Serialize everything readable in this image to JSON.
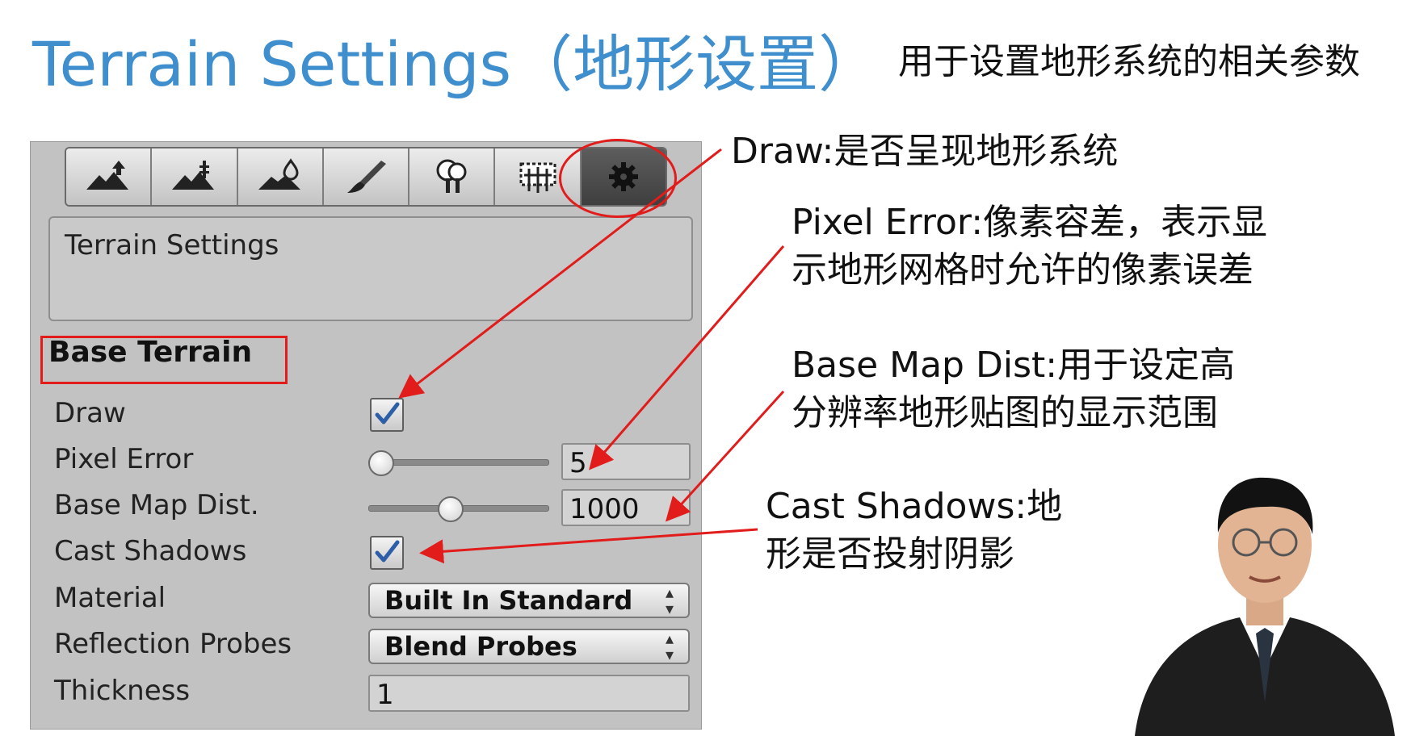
{
  "header": {
    "title": "Terrain Settings（地形设置）",
    "subtitle": "用于设置地形系统的相关参数"
  },
  "toolbar": {
    "tools": [
      {
        "icon": "raise-terrain-icon"
      },
      {
        "icon": "paint-height-icon"
      },
      {
        "icon": "smooth-height-icon"
      },
      {
        "icon": "paint-texture-icon"
      },
      {
        "icon": "place-trees-icon"
      },
      {
        "icon": "paint-details-icon"
      },
      {
        "icon": "terrain-settings-gear-icon",
        "active": true
      }
    ]
  },
  "description": {
    "text": "Terrain Settings"
  },
  "base_terrain": {
    "header": "Base Terrain",
    "draw": {
      "label": "Draw",
      "checked": true
    },
    "pixel_error": {
      "label": "Pixel Error",
      "value": "5",
      "slider_fraction": 0.0
    },
    "base_map_dist": {
      "label": "Base Map Dist.",
      "value": "1000",
      "slider_fraction": 0.45
    },
    "cast_shadows": {
      "label": "Cast Shadows",
      "checked": true
    },
    "material": {
      "label": "Material",
      "value": "Built In Standard"
    },
    "reflection_probes": {
      "label": "Reflection Probes",
      "value": "Blend Probes"
    },
    "thickness": {
      "label": "Thickness",
      "value": "1"
    }
  },
  "annotations": {
    "draw": "Draw:是否呈现地形系统",
    "pixel_error_line1": "Pixel Error:像素容差，表示显",
    "pixel_error_line2": "示地形网格时允许的像素误差",
    "base_map_line1": "Base Map Dist:用于设定高",
    "base_map_line2": "分辨率地形贴图的显示范围",
    "cast_shadows_line1": "Cast Shadows:地",
    "cast_shadows_line2": "形是否投射阴影"
  },
  "colors": {
    "title": "#3f8fce",
    "highlight": "#e21b1b",
    "panel_bg": "#c2c2c2",
    "checkmark": "#2c5fa8"
  }
}
